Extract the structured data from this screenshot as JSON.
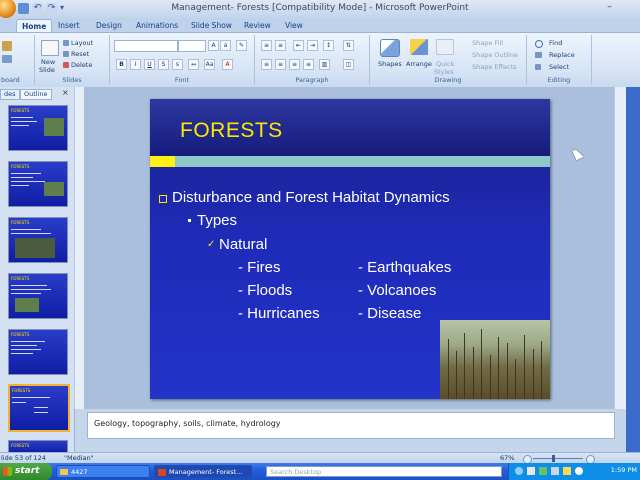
{
  "window": {
    "title": "Management- Forests [Compatibility Mode] - Microsoft PowerPoint"
  },
  "ribbon_tabs": [
    "Home",
    "Insert",
    "Design",
    "Animations",
    "Slide Show",
    "Review",
    "View"
  ],
  "ribbon": {
    "clipboard_label": "board",
    "slides": {
      "new_slide": "New",
      "new_slide_line2": "Slide",
      "layout": "Layout",
      "reset": "Reset",
      "delete": "Delete",
      "label": "Slides"
    },
    "font_label": "Font",
    "paragraph_label": "Paragraph",
    "drawing": {
      "shapes": "Shapes",
      "arrange": "Arrange",
      "quick_styles": "Quick",
      "quick_styles_line2": "Styles",
      "shape_fill": "Shape Fill",
      "shape_outline": "Shape Outline",
      "shape_effects": "Shape Effects",
      "label": "Drawing"
    },
    "editing": {
      "find": "Find",
      "replace": "Replace",
      "select": "Select",
      "label": "Editing"
    }
  },
  "left_pane": {
    "tabs": [
      "des",
      "Outline"
    ],
    "thumbnails": [
      {
        "number": "",
        "title": "FORESTS",
        "selected": false
      },
      {
        "number": "",
        "title": "FORESTS",
        "selected": false
      },
      {
        "number": "",
        "title": "FORESTS",
        "selected": false
      },
      {
        "number": "",
        "title": "FORESTS",
        "selected": false
      },
      {
        "number": "",
        "title": "FORESTS",
        "selected": false
      },
      {
        "number": "",
        "title": "FORESTS",
        "selected": true
      },
      {
        "number": "",
        "title": "FORESTS",
        "selected": false
      }
    ]
  },
  "slide": {
    "title": "FORESTS",
    "bullet1": "Disturbance and Forest Habitat Dynamics",
    "bullet2": "Types",
    "bullet3": "Natural",
    "items_left": [
      "- Fires",
      "- Floods",
      "- Hurricanes"
    ],
    "items_right": [
      "- Earthquakes",
      "- Volcanoes",
      "- Disease"
    ]
  },
  "notes": {
    "text": "Geology, topography, soils, climate, hydrology"
  },
  "status": {
    "slide_info": "lide 53 of 124",
    "theme": "\"Median\"",
    "zoom": "67%"
  },
  "taskbar": {
    "start": "start",
    "task1": "4427",
    "task2": "Management- Forest...",
    "search_placeholder": "Search Desktop",
    "clock": "1:59 PM"
  },
  "colors": {
    "slide_bg": "#1f2bb8",
    "title_yellow": "#ffe600",
    "teal_bar": "#8fc8c9",
    "ribbon_bg": "#d6e4f5",
    "taskbar_blue": "#245edc"
  }
}
